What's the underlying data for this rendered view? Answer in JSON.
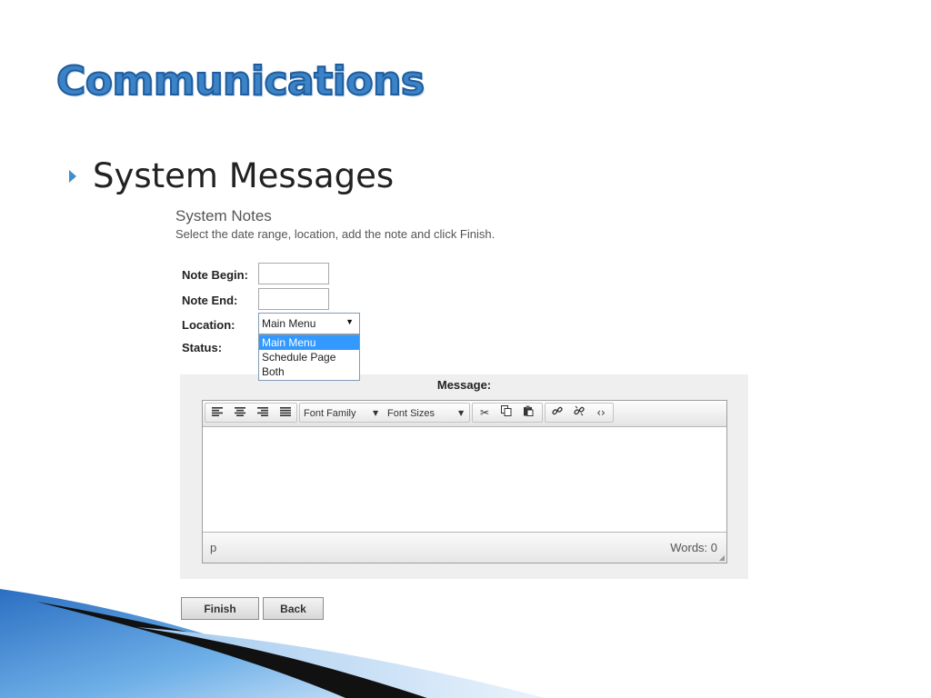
{
  "slide": {
    "title": "Communications",
    "bullet": "System Messages"
  },
  "notes": {
    "title": "System Notes",
    "subtitle": "Select the date range, location, add the note and click Finish."
  },
  "form": {
    "note_begin_label": "Note Begin:",
    "note_begin_value": "",
    "note_end_label": "Note End:",
    "note_end_value": "",
    "location_label": "Location:",
    "location_value": "Main Menu",
    "location_options": [
      "Main Menu",
      "Schedule Page",
      "Both"
    ],
    "status_label": "Status:"
  },
  "editor": {
    "message_label": "Message:",
    "font_family_label": "Font Family",
    "font_sizes_label": "Font Sizes",
    "path_text": "p",
    "word_count": "Words: 0",
    "toolbar_icons": [
      "align-left-icon",
      "align-center-icon",
      "align-right-icon",
      "align-justify-icon",
      "cut-icon",
      "copy-icon",
      "paste-icon",
      "link-icon",
      "unlink-icon",
      "source-code-icon"
    ]
  },
  "buttons": {
    "finish_label": "Finish",
    "back_label": "Back"
  },
  "colors": {
    "title_blue": "#3b82c6",
    "bullet_blue": "#3e8fd1",
    "selected_option": "#3399ff"
  }
}
